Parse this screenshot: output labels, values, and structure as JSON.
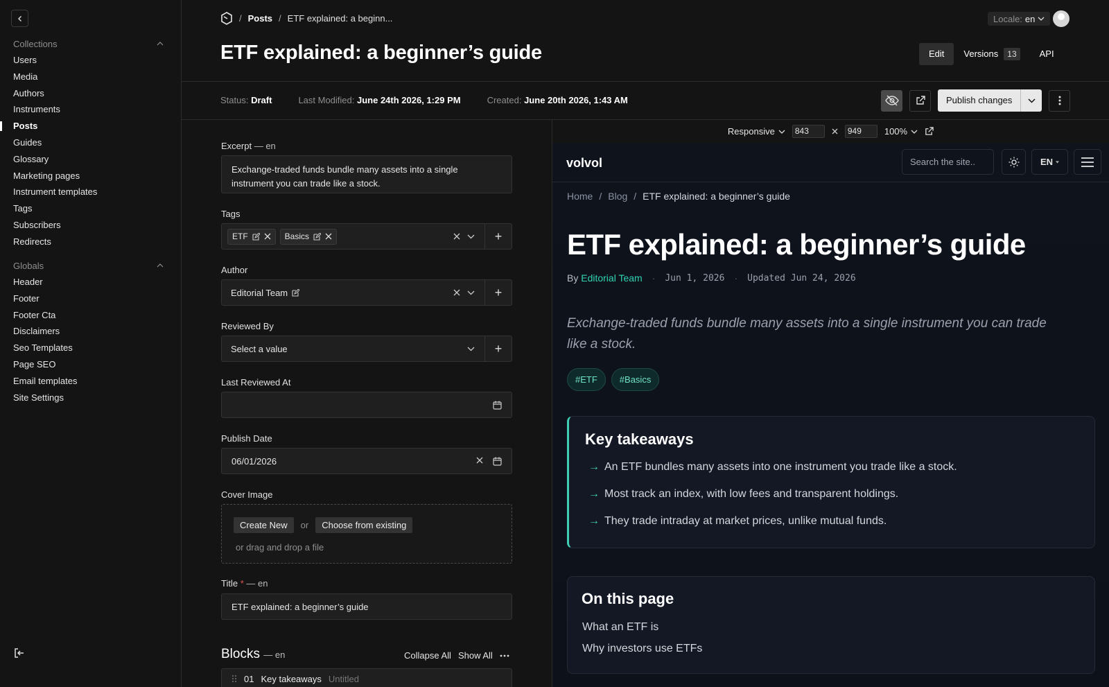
{
  "sidebar": {
    "collections_label": "Collections",
    "collections": [
      {
        "label": "Users"
      },
      {
        "label": "Media"
      },
      {
        "label": "Authors"
      },
      {
        "label": "Instruments"
      },
      {
        "label": "Posts"
      },
      {
        "label": "Guides"
      },
      {
        "label": "Glossary"
      },
      {
        "label": "Marketing pages"
      },
      {
        "label": "Instrument templates"
      },
      {
        "label": "Tags"
      },
      {
        "label": "Subscribers"
      },
      {
        "label": "Redirects"
      }
    ],
    "active_item": "Posts",
    "globals_label": "Globals",
    "globals": [
      {
        "label": "Header"
      },
      {
        "label": "Footer"
      },
      {
        "label": "Footer Cta"
      },
      {
        "label": "Disclaimers"
      },
      {
        "label": "Seo Templates"
      },
      {
        "label": "Page SEO"
      },
      {
        "label": "Email templates"
      },
      {
        "label": "Site Settings"
      }
    ]
  },
  "header": {
    "breadcrumb": [
      "Posts",
      "ETF explained: a beginn..."
    ],
    "locale_label": "Locale:",
    "locale_value": "en",
    "title": "ETF explained: a beginner’s guide",
    "tabs": {
      "edit": "Edit",
      "versions": "Versions",
      "versions_count": "13",
      "api": "API"
    }
  },
  "status": {
    "status_key": "Status:",
    "status_value": "Draft",
    "modified_key": "Last Modified:",
    "modified_value": "June 24th 2026, 1:29 PM",
    "created_key": "Created:",
    "created_value": "June 20th 2026, 1:43 AM",
    "publish_label": "Publish changes"
  },
  "form": {
    "excerpt_label": "Excerpt",
    "locale_suffix": "— en",
    "excerpt_value": "Exchange-traded funds bundle many assets into a single instrument you can trade like a stock.",
    "tags_label": "Tags",
    "tags": [
      "ETF",
      "Basics"
    ],
    "author_label": "Author",
    "author_value": "Editorial Team",
    "reviewed_by_label": "Reviewed By",
    "reviewed_by_placeholder": "Select a value",
    "last_reviewed_label": "Last Reviewed At",
    "publish_date_label": "Publish Date",
    "publish_date_value": "06/01/2026",
    "cover_label": "Cover Image",
    "create_new": "Create New",
    "or": "or",
    "choose_existing": "Choose from existing",
    "drag_drop": "or drag and drop a file",
    "title_label": "Title",
    "required_mark": "*",
    "title_value": "ETF explained: a beginner’s guide",
    "blocks_label": "Blocks",
    "collapse_all": "Collapse All",
    "show_all": "Show All",
    "block": {
      "index": "01",
      "type": "Key takeaways",
      "name": "Untitled"
    }
  },
  "preview_toolbar": {
    "mode": "Responsive",
    "width": "843",
    "height": "949",
    "zoom": "100%"
  },
  "preview": {
    "logo": "volvol",
    "search_placeholder": "Search the site..",
    "lang": "EN",
    "crumbs": [
      "Home",
      "Blog",
      "ETF explained: a beginner’s guide"
    ],
    "title": "ETF explained: a beginner’s guide",
    "by": "By",
    "author": "Editorial Team",
    "date": "Jun 1, 2026",
    "updated": "Updated Jun 24, 2026",
    "excerpt": "Exchange-traded funds bundle many assets into a single instrument you can trade like a stock.",
    "tags": [
      "#ETF",
      "#Basics"
    ],
    "takeaways_title": "Key takeaways",
    "takeaways": [
      "An ETF bundles many assets into one instrument you trade like a stock.",
      "Most track an index, with low fees and transparent holdings.",
      "They trade intraday at market prices, unlike mutual funds."
    ],
    "otp_title": "On this page",
    "otp_links": [
      "What an ETF is",
      "Why investors use ETFs"
    ]
  },
  "colors": {
    "accent": "#3fd0b4",
    "bg": "#141414",
    "preview_bg": "#0f131c"
  }
}
